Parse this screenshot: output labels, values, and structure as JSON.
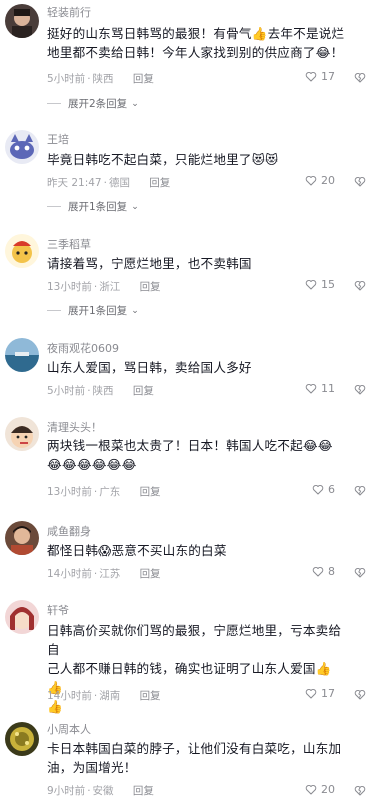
{
  "comments": [
    {
      "user": "轻装前行",
      "text_lines": [
        "挺好的山东骂日韩骂的最狠！有骨气👍去年不是说烂",
        "地里都不卖给日韩！今年人家找到别的供应商了😂！"
      ],
      "time": "5小时前",
      "location": "陕西",
      "reply_label": "回复",
      "likes": "17",
      "expand": "展开2条回复"
    },
    {
      "user": "王培",
      "text_lines": [
        "毕竟日韩吃不起白菜，只能烂地里了😻😻"
      ],
      "time": "昨天 21:47",
      "location": "德国",
      "reply_label": "回复",
      "likes": "20",
      "expand": "展开1条回复"
    },
    {
      "user": "三季稻草",
      "text_lines": [
        "请接着骂，宁愿烂地里，也不卖韩国"
      ],
      "time": "13小时前",
      "location": "浙江",
      "reply_label": "回复",
      "likes": "15",
      "expand": "展开1条回复"
    },
    {
      "user": "夜雨观花0609",
      "text_lines": [
        "山东人爱国，骂日韩，卖给国人多好"
      ],
      "time": "5小时前",
      "location": "陕西",
      "reply_label": "回复",
      "likes": "11"
    },
    {
      "user": "清理头头！",
      "text_lines": [
        "两块钱一根菜也太贵了！日本！韩国人吃不起😂😂",
        "😂😂😂😂😂😂"
      ],
      "time": "13小时前",
      "location": "广东",
      "reply_label": "回复",
      "likes": "6"
    },
    {
      "user": "咸鱼翻身",
      "text_lines": [
        "都怪日韩😱恶意不买山东的白菜"
      ],
      "time": "14小时前",
      "location": "江苏",
      "reply_label": "回复",
      "likes": "8"
    },
    {
      "user": "轩爷",
      "text_lines": [
        "日韩高价买就你们骂的最狠，宁愿烂地里，亏本卖给自",
        "己人都不赚日韩的钱，确实也证明了山东人爱国👍👍",
        "👍"
      ],
      "time": "14小时前",
      "location": "湖南",
      "reply_label": "回复",
      "likes": "17"
    },
    {
      "user": "小周本人",
      "text_lines": [
        "卡日本韩国白菜的脖子，让他们没有白菜吃，山东加",
        "油，为国增光！"
      ],
      "time": "9小时前",
      "location": "安徽",
      "reply_label": "回复",
      "likes": "20"
    }
  ]
}
